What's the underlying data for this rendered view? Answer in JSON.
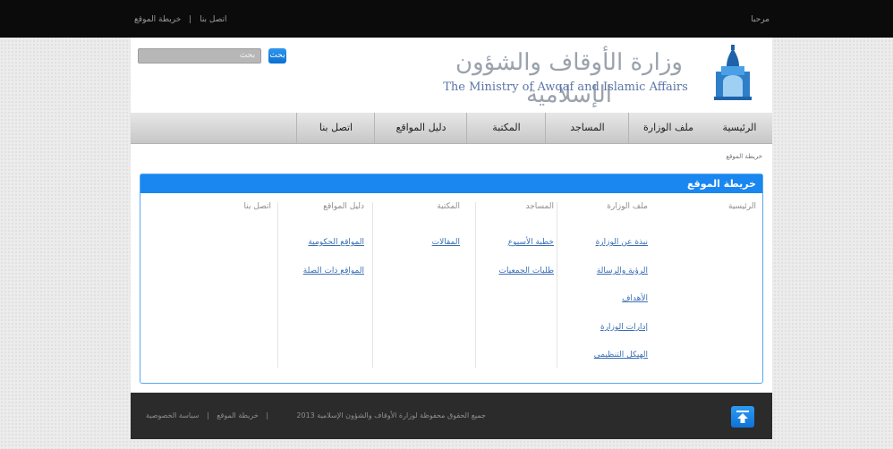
{
  "topbar": {
    "links": [
      "اتصل بنا",
      "خريطة الموقع"
    ],
    "separator": "|",
    "welcome": "مرحبا"
  },
  "header": {
    "search_placeholder": "بحث",
    "search_button": "بحث",
    "logo_arabic": "وزارة الأوقاف والشؤون الإسلامية",
    "logo_english": "The Ministry of Awqaf and Islamic Affairs"
  },
  "nav": {
    "items": [
      {
        "label": "الرئيسية"
      },
      {
        "label": "ملف الوزارة"
      },
      {
        "label": "المساجد"
      },
      {
        "label": "المكتبة"
      },
      {
        "label": "دليل المواقع"
      },
      {
        "label": "اتصل بنا"
      }
    ]
  },
  "content": {
    "breadcrumb": "خريطة الموقع",
    "panel_title": "خريطة الموقع",
    "columns": [
      {
        "heading": "الرئيسية",
        "links": []
      },
      {
        "heading": "ملف الوزارة",
        "links": [
          "نبذة عن الوزارة",
          "الرؤية والرسالة",
          "الأهداف",
          "إدارات الوزارة",
          "الهيكل التنظيمي"
        ]
      },
      {
        "heading": "المساجد",
        "links": [
          "خطبة الأسبوع",
          "طلبات الجمعيات"
        ]
      },
      {
        "heading": "المكتبة",
        "links": [
          "المقالات"
        ]
      },
      {
        "heading": "دليل المواقع",
        "links": [
          "المواقع الحكومية",
          "المواقع ذات الصلة"
        ]
      },
      {
        "heading": "اتصل بنا",
        "links": []
      }
    ]
  },
  "footer": {
    "copyright": "جميع الحقوق محفوظة لوزارة الأوقاف والشؤون الإسلامية 2013",
    "links": [
      "سياسة الخصوصية",
      "خريطة الموقع"
    ],
    "separator": "|"
  },
  "colors": {
    "accent_blue": "#1a87f0",
    "topbar": "#0b0b0b",
    "footer": "#2b2b2b"
  }
}
